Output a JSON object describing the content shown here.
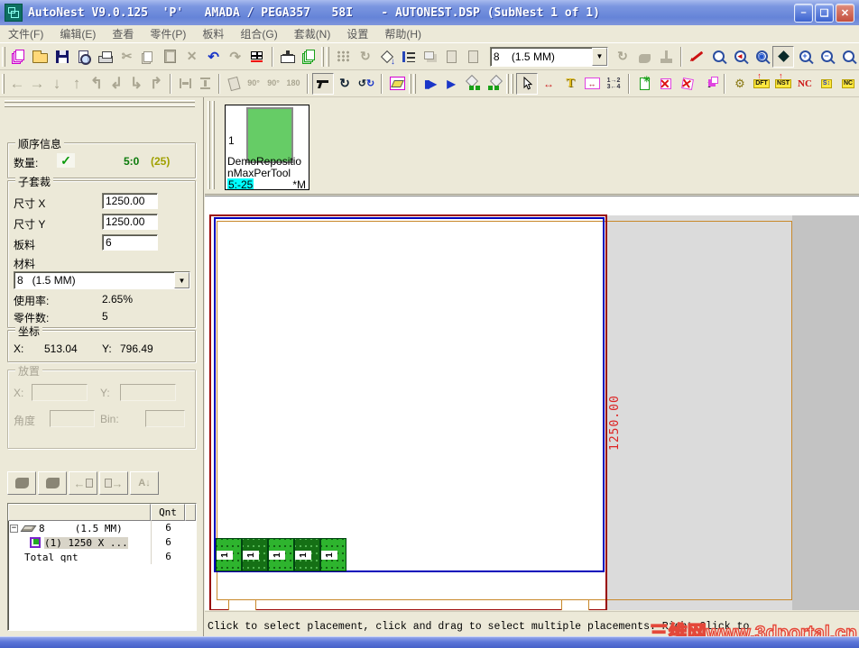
{
  "title": {
    "text": "AutoNest V9.0.125  'P'   AMADA / PEGA357   58I    - AUTONEST.DSP (SubNest 1 of 1)"
  },
  "window_controls": {
    "minimize": "–",
    "maximize": "❑",
    "close": "✕"
  },
  "menu": {
    "items": [
      "文件(F)",
      "编辑(E)",
      "查看",
      "零件(P)",
      "板料",
      "组合(G)",
      "套裁(N)",
      "设置",
      "帮助(H)"
    ]
  },
  "icons": {
    "arrow_left": "←",
    "arrow_right": "→",
    "arrow_down": "↓",
    "arrow_up": "↑",
    "arrow_turn_ul": "↰",
    "arrow_turn_dl": "↲",
    "arrow_turn_dr": "↳",
    "arrow_turn_ur": "↱",
    "undo": "↶",
    "redo": "↷",
    "rotate": "↻",
    "rotate2": "↺",
    "scissors": "✂",
    "gear": "⚙",
    "delete_x": "✕",
    "play": "▶",
    "play_bar": "▮▶",
    "check": "✓",
    "diamond_arrow": "↓",
    "sort_az": "A↓",
    "measure": "↔"
  },
  "toolbar": {
    "material_combo": "8    (1.5 MM)",
    "rotate_labels": [
      "90°",
      "90°",
      "180"
    ],
    "dft": "DFT",
    "nst": "NST",
    "nc": "NC",
    "s1": "S↕",
    "nc2": "NC",
    "t_label": "T",
    "info": "i",
    "seq_top": "1→2",
    "seq_bottom": "3←4",
    "measure_q": "?"
  },
  "sidebar": {
    "order_group": {
      "title": "顺序信息",
      "qty_label": "数量:",
      "qty_value": "5:0",
      "qty_extra": "(25)"
    },
    "subnest_group": {
      "title": "子套裁",
      "size_x_label": "尺寸 X",
      "size_x": "1250.00",
      "size_y_label": "尺寸 Y",
      "size_y": "1250.00",
      "sheets_label": "板料",
      "sheets": "6",
      "material_label": "材料",
      "material": "8   (1.5 MM)",
      "usage_label": "使用率:",
      "usage": "2.65%",
      "parts_label": "零件数:",
      "parts": "5"
    },
    "coord_group": {
      "title": "坐标",
      "x_label": "X:",
      "x": "513.04",
      "y_label": "Y:",
      "y": "796.49"
    },
    "place_group": {
      "title": "放置",
      "x_label": "X:",
      "y_label": "Y:",
      "angle_label": "角度",
      "bin_label": "Bin:"
    },
    "table": {
      "qnt_header": "Qnt",
      "rows": [
        {
          "label": "8     (1.5 MM)",
          "qnt": "6"
        },
        {
          "label": "(1) 1250 X ...",
          "qnt": "6"
        },
        {
          "label": "Total qnt",
          "qnt": "6"
        }
      ]
    }
  },
  "parts_panel": {
    "card": {
      "index": "1",
      "name_line1": "DemoRepositio",
      "name_line2": "nMaxPerTool",
      "tool_range": "5:-25",
      "flag": "*M"
    }
  },
  "canvas": {
    "dimension_label": "1250.00",
    "part_label": "1"
  },
  "statusbar": {
    "text": "Click to select placement, click and drag to select multiple placements. Right Click to",
    "watermark": "三维网www.3dportal.cn"
  }
}
